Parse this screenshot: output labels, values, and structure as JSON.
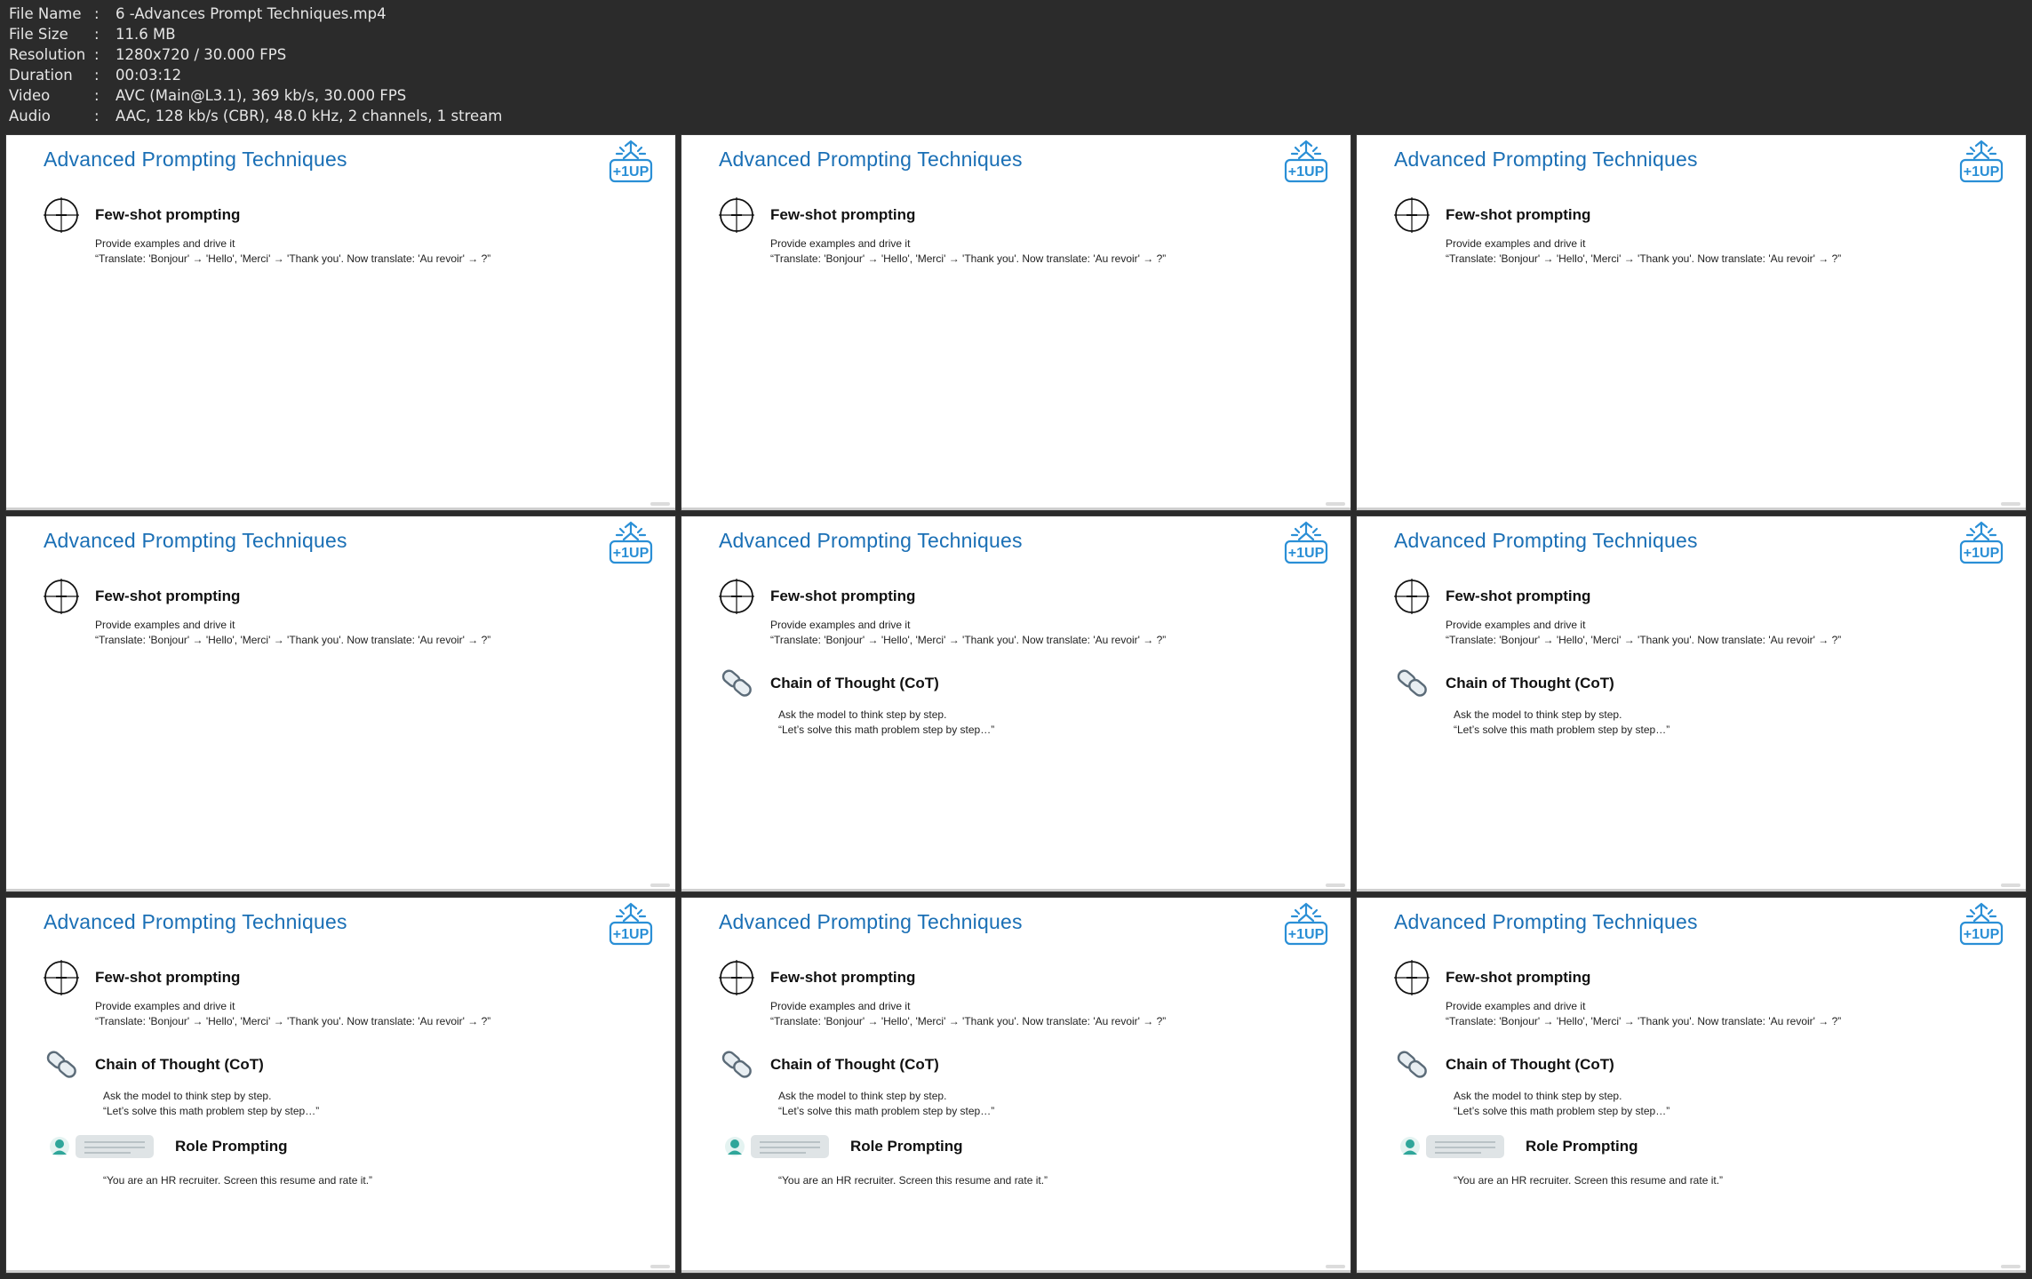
{
  "metadata": [
    {
      "key": "File Name",
      "sep": ":",
      "value": "6 -Advances Prompt Techniques.mp4"
    },
    {
      "key": "File Size",
      "sep": ":",
      "value": "11.6 MB"
    },
    {
      "key": "Resolution",
      "sep": ":",
      "value": "1280x720 / 30.000 FPS"
    },
    {
      "key": "Duration",
      "sep": ":",
      "value": "00:03:12"
    },
    {
      "key": "Video",
      "sep": ":",
      "value": "AVC (Main@L3.1), 369 kb/s, 30.000 FPS"
    },
    {
      "key": "Audio",
      "sep": ":",
      "value": "AAC, 128 kb/s (CBR), 48.0 kHz, 2 channels, 1 stream"
    }
  ],
  "slide": {
    "title": "Advanced Prompting Techniques",
    "logo_text": "+1UP",
    "few_shot": {
      "heading": "Few-shot prompting",
      "line1": "Provide examples and drive it",
      "line2": "“Translate: 'Bonjour' → 'Hello', 'Merci' → 'Thank you'. Now translate: 'Au revoir' → ?”"
    },
    "cot": {
      "heading": "Chain of Thought (CoT)",
      "line1": "Ask the model to think step by step.",
      "line2": "“Let’s solve this math problem step by step…”"
    },
    "role": {
      "heading": "Role Prompting",
      "line1": "“You are an HR recruiter. Screen this resume and rate it.”"
    }
  },
  "thumbnails": [
    {
      "sections": 1
    },
    {
      "sections": 1
    },
    {
      "sections": 1
    },
    {
      "sections": 1
    },
    {
      "sections": 2
    },
    {
      "sections": 2
    },
    {
      "sections": 3
    },
    {
      "sections": 3
    },
    {
      "sections": 3
    }
  ],
  "colors": {
    "title": "#1a6fb5",
    "logo": "#2a8fd6",
    "role_icon": "#2fa69a",
    "background": "#2b2b2b"
  },
  "icons": {
    "few_shot": "crosshair-icon",
    "cot": "chain-link-icon",
    "role": "chat-avatar-icon",
    "logo": "plus-one-up-logo"
  }
}
